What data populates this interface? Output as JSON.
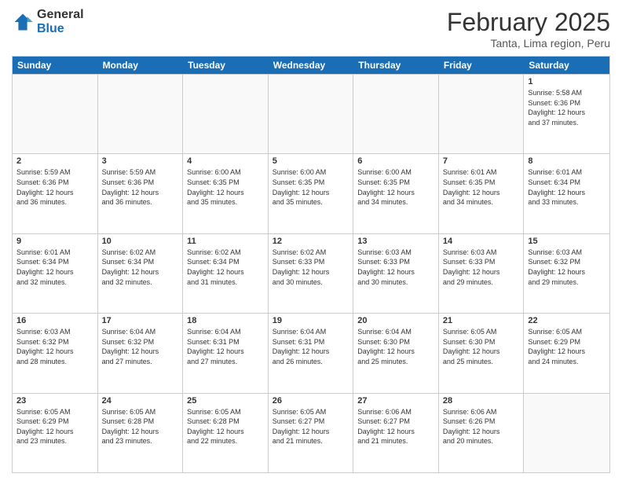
{
  "header": {
    "logo_line1": "General",
    "logo_line2": "Blue",
    "title": "February 2025",
    "subtitle": "Tanta, Lima region, Peru"
  },
  "calendar": {
    "days_of_week": [
      "Sunday",
      "Monday",
      "Tuesday",
      "Wednesday",
      "Thursday",
      "Friday",
      "Saturday"
    ],
    "weeks": [
      [
        {
          "day": "",
          "info": ""
        },
        {
          "day": "",
          "info": ""
        },
        {
          "day": "",
          "info": ""
        },
        {
          "day": "",
          "info": ""
        },
        {
          "day": "",
          "info": ""
        },
        {
          "day": "",
          "info": ""
        },
        {
          "day": "1",
          "info": "Sunrise: 5:58 AM\nSunset: 6:36 PM\nDaylight: 12 hours\nand 37 minutes."
        }
      ],
      [
        {
          "day": "2",
          "info": "Sunrise: 5:59 AM\nSunset: 6:36 PM\nDaylight: 12 hours\nand 36 minutes."
        },
        {
          "day": "3",
          "info": "Sunrise: 5:59 AM\nSunset: 6:36 PM\nDaylight: 12 hours\nand 36 minutes."
        },
        {
          "day": "4",
          "info": "Sunrise: 6:00 AM\nSunset: 6:35 PM\nDaylight: 12 hours\nand 35 minutes."
        },
        {
          "day": "5",
          "info": "Sunrise: 6:00 AM\nSunset: 6:35 PM\nDaylight: 12 hours\nand 35 minutes."
        },
        {
          "day": "6",
          "info": "Sunrise: 6:00 AM\nSunset: 6:35 PM\nDaylight: 12 hours\nand 34 minutes."
        },
        {
          "day": "7",
          "info": "Sunrise: 6:01 AM\nSunset: 6:35 PM\nDaylight: 12 hours\nand 34 minutes."
        },
        {
          "day": "8",
          "info": "Sunrise: 6:01 AM\nSunset: 6:34 PM\nDaylight: 12 hours\nand 33 minutes."
        }
      ],
      [
        {
          "day": "9",
          "info": "Sunrise: 6:01 AM\nSunset: 6:34 PM\nDaylight: 12 hours\nand 32 minutes."
        },
        {
          "day": "10",
          "info": "Sunrise: 6:02 AM\nSunset: 6:34 PM\nDaylight: 12 hours\nand 32 minutes."
        },
        {
          "day": "11",
          "info": "Sunrise: 6:02 AM\nSunset: 6:34 PM\nDaylight: 12 hours\nand 31 minutes."
        },
        {
          "day": "12",
          "info": "Sunrise: 6:02 AM\nSunset: 6:33 PM\nDaylight: 12 hours\nand 30 minutes."
        },
        {
          "day": "13",
          "info": "Sunrise: 6:03 AM\nSunset: 6:33 PM\nDaylight: 12 hours\nand 30 minutes."
        },
        {
          "day": "14",
          "info": "Sunrise: 6:03 AM\nSunset: 6:33 PM\nDaylight: 12 hours\nand 29 minutes."
        },
        {
          "day": "15",
          "info": "Sunrise: 6:03 AM\nSunset: 6:32 PM\nDaylight: 12 hours\nand 29 minutes."
        }
      ],
      [
        {
          "day": "16",
          "info": "Sunrise: 6:03 AM\nSunset: 6:32 PM\nDaylight: 12 hours\nand 28 minutes."
        },
        {
          "day": "17",
          "info": "Sunrise: 6:04 AM\nSunset: 6:32 PM\nDaylight: 12 hours\nand 27 minutes."
        },
        {
          "day": "18",
          "info": "Sunrise: 6:04 AM\nSunset: 6:31 PM\nDaylight: 12 hours\nand 27 minutes."
        },
        {
          "day": "19",
          "info": "Sunrise: 6:04 AM\nSunset: 6:31 PM\nDaylight: 12 hours\nand 26 minutes."
        },
        {
          "day": "20",
          "info": "Sunrise: 6:04 AM\nSunset: 6:30 PM\nDaylight: 12 hours\nand 25 minutes."
        },
        {
          "day": "21",
          "info": "Sunrise: 6:05 AM\nSunset: 6:30 PM\nDaylight: 12 hours\nand 25 minutes."
        },
        {
          "day": "22",
          "info": "Sunrise: 6:05 AM\nSunset: 6:29 PM\nDaylight: 12 hours\nand 24 minutes."
        }
      ],
      [
        {
          "day": "23",
          "info": "Sunrise: 6:05 AM\nSunset: 6:29 PM\nDaylight: 12 hours\nand 23 minutes."
        },
        {
          "day": "24",
          "info": "Sunrise: 6:05 AM\nSunset: 6:28 PM\nDaylight: 12 hours\nand 23 minutes."
        },
        {
          "day": "25",
          "info": "Sunrise: 6:05 AM\nSunset: 6:28 PM\nDaylight: 12 hours\nand 22 minutes."
        },
        {
          "day": "26",
          "info": "Sunrise: 6:05 AM\nSunset: 6:27 PM\nDaylight: 12 hours\nand 21 minutes."
        },
        {
          "day": "27",
          "info": "Sunrise: 6:06 AM\nSunset: 6:27 PM\nDaylight: 12 hours\nand 21 minutes."
        },
        {
          "day": "28",
          "info": "Sunrise: 6:06 AM\nSunset: 6:26 PM\nDaylight: 12 hours\nand 20 minutes."
        },
        {
          "day": "",
          "info": ""
        }
      ]
    ]
  }
}
